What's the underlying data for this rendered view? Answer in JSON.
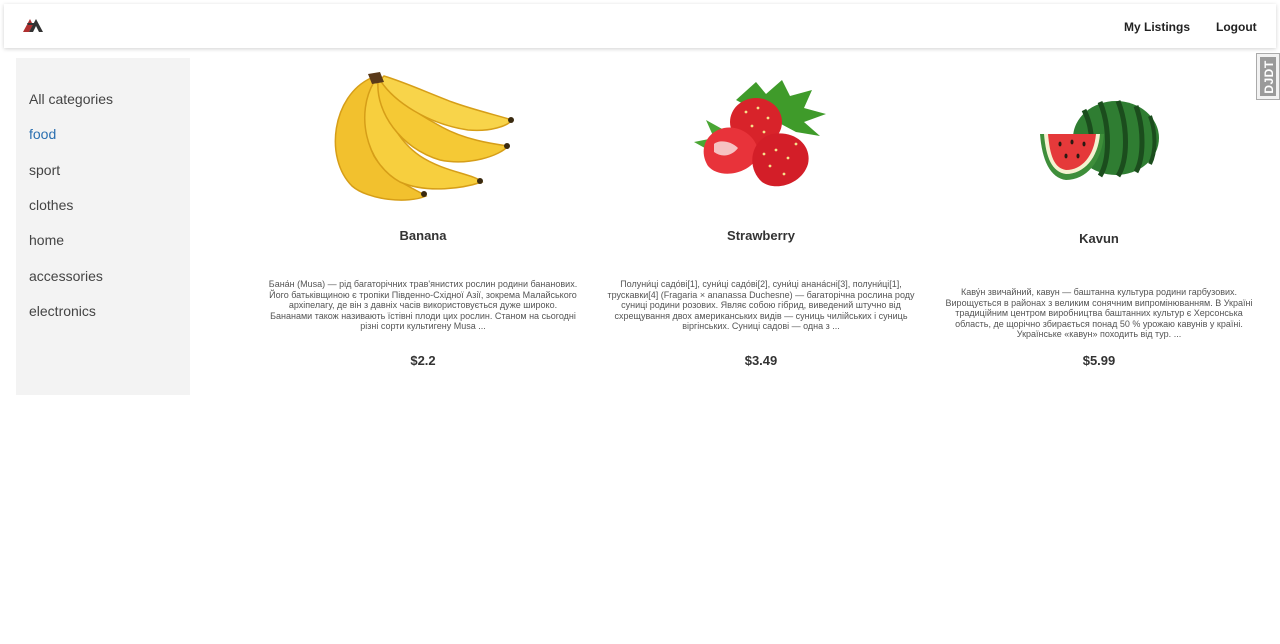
{
  "header": {
    "logo_icon": "bolt-logo",
    "nav": {
      "my_listings": "My Listings",
      "logout": "Logout"
    }
  },
  "sidebar": {
    "active": "food",
    "active_color": "#2a6fb0",
    "categories": [
      {
        "label": "All categories"
      },
      {
        "label": "food"
      },
      {
        "label": "sport"
      },
      {
        "label": "clothes"
      },
      {
        "label": "home"
      },
      {
        "label": "accessories"
      },
      {
        "label": "electronics"
      }
    ]
  },
  "products": [
    {
      "name": "Banana",
      "image_icon": "banana-image",
      "description": "Бана́н (Musa) — рід багаторічних трав'янистих рослин родини бананових. Його батьківщиною є тропіки Південно-Східної Азії, зокрема Малайського архіпелагу, де він з давніх часів використовується дуже широко. Бананами також називають їстівні плоди цих рослин. Станом на сьогодні різні сорти культигену Musa ...",
      "price": "$2.2"
    },
    {
      "name": "Strawberry",
      "image_icon": "strawberry-image",
      "description": "Полуни́ці садо́ві[1], суни́ці садо́ві[2], суни́ці анана́сні[3], полуни́ці[1], трускавки[4] (Fragaria × ananassa Duchesne) — багаторічна рослина роду суниці родини розових. Являє собою гібрид, виведений штучно від схрещування двох американських видів — суниць чилійських і суниць віргінських. Суниці садові — одна з ...",
      "price": "$3.49"
    },
    {
      "name": "Kavun",
      "image_icon": "watermelon-image",
      "description": "Каву́н звичайний, кавун — баштанна культура родини гарбузових. Вирощується в районах з великим сонячним випромінюванням. В Україні традиційним центром виробництва баштанних культур є Херсонська область, де щорічно збирається понад 50 % урожаю кавунів у країні. Українське «кавун» походить від тур. ...",
      "price": "$5.99"
    }
  ],
  "side_widget": {
    "label": "DJDT",
    "icon": "debug-toolbar-tab"
  }
}
